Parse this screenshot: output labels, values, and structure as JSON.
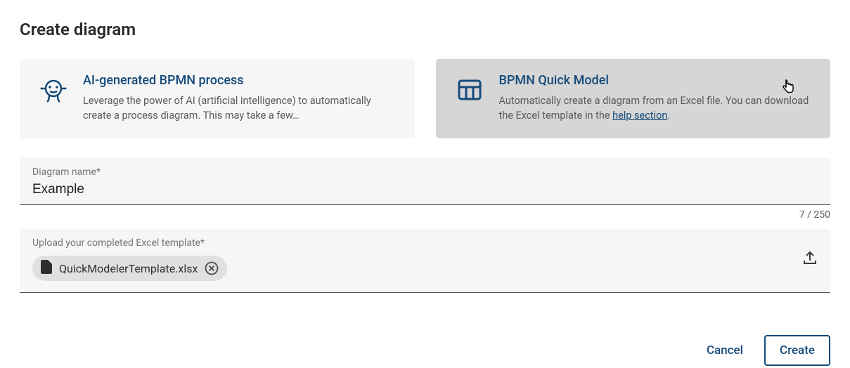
{
  "header": {
    "title": "Create diagram"
  },
  "cards": {
    "ai": {
      "title": "AI-generated BPMN process",
      "description": "Leverage the power of AI (artificial intelligence) to automatically create a process diagram. This may take a few…"
    },
    "quick": {
      "title": "BPMN Quick Model",
      "description_pre": "Automatically create a diagram from an Excel file. You can download the Excel template in the ",
      "help_link": "help section",
      "description_post": "."
    }
  },
  "name_field": {
    "label": "Diagram name*",
    "value": "Example",
    "counter": "7 / 250"
  },
  "upload_field": {
    "label": "Upload your completed Excel template*",
    "file_name": "QuickModelerTemplate.xlsx"
  },
  "footer": {
    "cancel": "Cancel",
    "create": "Create"
  }
}
